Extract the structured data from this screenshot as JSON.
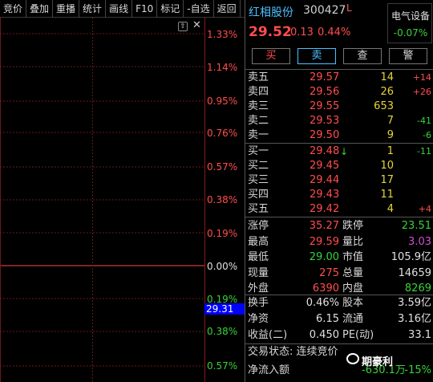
{
  "toolbar": {
    "items": [
      "竞价",
      "叠加",
      "重播",
      "统计",
      "画线",
      "F10",
      "标记",
      "-自选",
      "返回"
    ]
  },
  "chart": {
    "pct_labels": [
      {
        "text": "1.33%",
        "color": "#ff4d4d"
      },
      {
        "text": "1.14%",
        "color": "#ff4d4d"
      },
      {
        "text": "0.95%",
        "color": "#ff4d4d"
      },
      {
        "text": "0.76%",
        "color": "#ff4d4d"
      },
      {
        "text": "0.57%",
        "color": "#ff4d4d"
      },
      {
        "text": "0.38%",
        "color": "#ff4d4d"
      },
      {
        "text": "0.19%",
        "color": "#ff4d4d"
      },
      {
        "text": "0.00%",
        "color": "#e0e0e0"
      },
      {
        "text": "0.19%",
        "color": "#39d339"
      },
      {
        "text": "0.38%",
        "color": "#39d339"
      },
      {
        "text": "0.57%",
        "color": "#39d339"
      }
    ],
    "current_price_flag": "29.31",
    "collapse_icon": "up-arrow-box-icon",
    "close_icon": "close-icon"
  },
  "header": {
    "name": "红相股份",
    "code": "300427",
    "mark": "L",
    "sector_name": "电气设备",
    "sector_pct": "-0.07%",
    "price": "29.52",
    "change": "0.13",
    "pct": "0.44%"
  },
  "buttons": [
    {
      "label": "买",
      "color": "#ff4d4d"
    },
    {
      "label": "卖",
      "color": "#4ec0ff"
    },
    {
      "label": "查",
      "color": "#d8d8d8"
    },
    {
      "label": "警",
      "color": "#d8d8d8"
    }
  ],
  "asks": [
    {
      "label": "卖五",
      "price": "29.57",
      "vol": "14",
      "delta": "+14",
      "delta_color": "red"
    },
    {
      "label": "卖四",
      "price": "29.56",
      "vol": "26",
      "delta": "+26",
      "delta_color": "red"
    },
    {
      "label": "卖三",
      "price": "29.55",
      "vol": "653",
      "delta": "",
      "delta_color": "red"
    },
    {
      "label": "卖二",
      "price": "29.53",
      "vol": "7",
      "delta": "-41",
      "delta_color": "green"
    },
    {
      "label": "卖一",
      "price": "29.50",
      "vol": "9",
      "delta": "-6",
      "delta_color": "green"
    }
  ],
  "bids": [
    {
      "label": "买一",
      "price": "29.48",
      "arrow": "↓",
      "vol": "1",
      "delta": "-11",
      "delta_color": "green"
    },
    {
      "label": "买二",
      "price": "29.45",
      "arrow": "",
      "vol": "10",
      "delta": "",
      "delta_color": "red"
    },
    {
      "label": "买三",
      "price": "29.44",
      "arrow": "",
      "vol": "17",
      "delta": "",
      "delta_color": "red"
    },
    {
      "label": "买四",
      "price": "29.43",
      "arrow": "",
      "vol": "11",
      "delta": "",
      "delta_color": "red"
    },
    {
      "label": "买五",
      "price": "29.42",
      "arrow": "",
      "vol": "4",
      "delta": "+4",
      "delta_color": "red"
    }
  ],
  "stats1": [
    {
      "l1": "涨停",
      "v1": "35.27",
      "c1": "#ff4d4d",
      "l2": "跌停",
      "v2": "23.51",
      "c2": "#39d339"
    },
    {
      "l1": "最高",
      "v1": "29.59",
      "c1": "#ff4d4d",
      "l2": "量比",
      "v2": "3.03",
      "c2": "#d050d0"
    },
    {
      "l1": "最低",
      "v1": "29.00",
      "c1": "#39d339",
      "l2": "市值",
      "v2": "105.9亿",
      "c2": "#e0e0e0"
    },
    {
      "l1": "现量",
      "v1": "275",
      "c1": "#ff4d4d",
      "l2": "总量",
      "v2": "14659",
      "c2": "#e0e0e0"
    },
    {
      "l1": "外盘",
      "v1": "6390",
      "c1": "#ff4d4d",
      "l2": "内盘",
      "v2": "8269",
      "c2": "#39d339"
    }
  ],
  "stats2": [
    {
      "l1": "换手",
      "v1": "0.46%",
      "c1": "#e0e0e0",
      "l2": "股本",
      "v2": "3.59亿",
      "c2": "#e0e0e0"
    },
    {
      "l1": "净资",
      "v1": "6.15",
      "c1": "#e0e0e0",
      "l2": "流通",
      "v2": "3.16亿",
      "c2": "#e0e0e0"
    },
    {
      "l1": "收益(二)",
      "v1": "0.450",
      "c1": "#e0e0e0",
      "l2": "PE(动)",
      "v2": "33.1",
      "c2": "#e0e0e0"
    }
  ],
  "status": {
    "label": "交易状态:",
    "value": "连续竞价"
  },
  "flow": {
    "label": "净流入额",
    "value": "-630.1万",
    "pct": "-15%"
  },
  "watermark": "期豪利"
}
